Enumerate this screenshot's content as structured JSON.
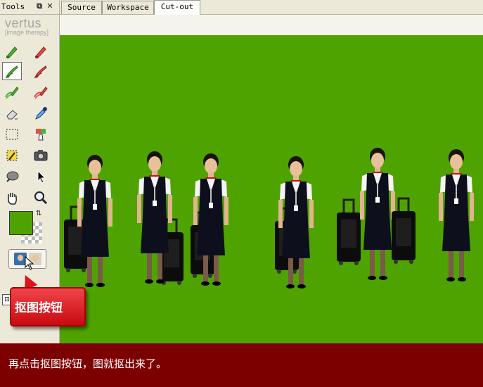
{
  "tools_panel": {
    "title": "Tools",
    "dock_icon": "dock-icon",
    "close_icon": "close-icon",
    "logo": "vertus",
    "logo_tagline": "[image therapy]",
    "tools": [
      {
        "name": "keep-brush-icon",
        "selected": false
      },
      {
        "name": "remove-brush-icon",
        "selected": false
      },
      {
        "name": "keep-fill-brush-icon",
        "selected": true
      },
      {
        "name": "remove-fill-brush-icon",
        "selected": false
      },
      {
        "name": "keep-edge-brush-icon",
        "selected": false
      },
      {
        "name": "remove-edge-brush-icon",
        "selected": false
      },
      {
        "name": "eraser-icon",
        "selected": false
      },
      {
        "name": "eyedropper-icon",
        "selected": false
      },
      {
        "name": "selection-rectangle-icon",
        "selected": false
      },
      {
        "name": "color-bucket-icon",
        "selected": false
      },
      {
        "name": "magic-wand-icon",
        "selected": false
      },
      {
        "name": "camera-icon",
        "selected": false
      },
      {
        "name": "smudge-icon",
        "selected": false
      },
      {
        "name": "pointer-icon",
        "selected": false
      },
      {
        "name": "hand-icon",
        "selected": false
      },
      {
        "name": "zoom-icon",
        "selected": false
      }
    ],
    "foreground_color": "#4fa300",
    "swap_icon": "swap-colors-icon",
    "cutout_button_icon": "cutout-faces-icon"
  },
  "tabs": [
    {
      "label": "Source",
      "active": false
    },
    {
      "label": "Workspace",
      "active": false
    },
    {
      "label": "Cut-out",
      "active": true
    }
  ],
  "canvas": {
    "background": "#4fa300"
  },
  "callout": {
    "label": "抠图按钮"
  },
  "caption": {
    "text": "再点击抠图按钮，图就抠出来了。"
  }
}
